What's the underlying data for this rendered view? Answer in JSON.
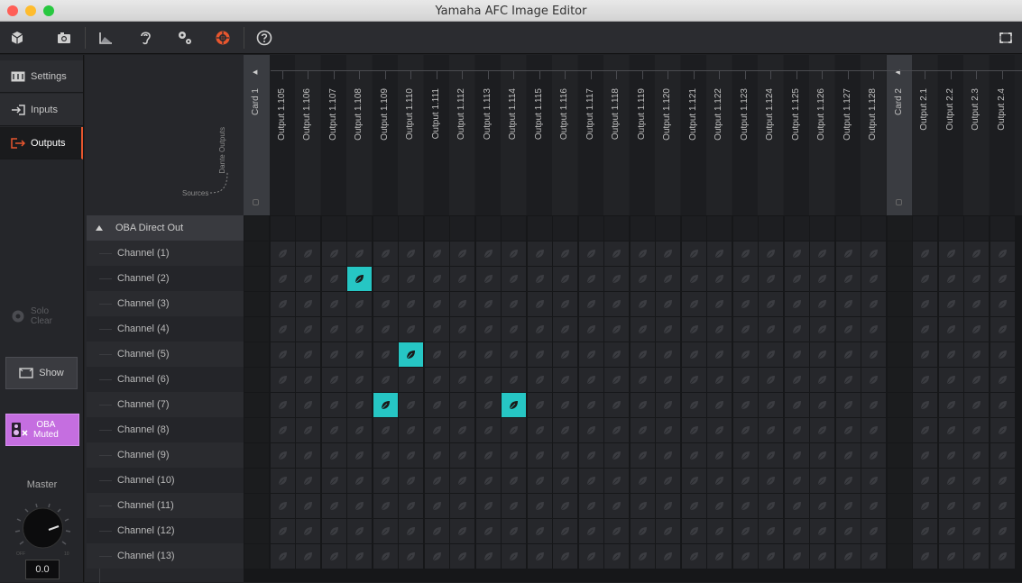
{
  "window": {
    "title": "Yamaha AFC Image Editor",
    "traffic_colors": [
      "#ff5f57",
      "#febc2e",
      "#28c840"
    ]
  },
  "toolbar": {
    "items": [
      {
        "name": "cube-icon"
      },
      {
        "name": "camera-icon"
      },
      {
        "name": "room-icon"
      },
      {
        "name": "ear-icon"
      },
      {
        "name": "gears-icon"
      },
      {
        "name": "speaker-routing-icon",
        "active": true
      },
      {
        "name": "help-icon"
      }
    ],
    "accent": "#e8562e"
  },
  "sidebar": {
    "settings_label": "Settings",
    "inputs_label": "Inputs",
    "outputs_label": "Outputs",
    "solo_label": "Solo",
    "clear_label": "Clear",
    "show_label": "Show",
    "oba_label": "OBA",
    "muted_label": "Muted",
    "master_label": "Master",
    "master_value": "0.0",
    "knob_min_label": "OFF",
    "knob_max_label": "10"
  },
  "legend": {
    "sources_label": "Sources",
    "dante_outputs_label": "Dante Outputs"
  },
  "rows": {
    "group_label": "OBA Direct Out",
    "channels": [
      "Channel (1)",
      "Channel (2)",
      "Channel (3)",
      "Channel (4)",
      "Channel (5)",
      "Channel (6)",
      "Channel (7)",
      "Channel (8)",
      "Channel (9)",
      "Channel (10)",
      "Channel (11)",
      "Channel (12)",
      "Channel (13)"
    ]
  },
  "columns": [
    {
      "label": "Card 1",
      "card": true
    },
    {
      "label": "Output 1.105"
    },
    {
      "label": "Output 1.106"
    },
    {
      "label": "Output 1.107"
    },
    {
      "label": "Output 1.108"
    },
    {
      "label": "Output 1.109"
    },
    {
      "label": "Output 1.110"
    },
    {
      "label": "Output 1.111"
    },
    {
      "label": "Output 1.112"
    },
    {
      "label": "Output 1.113"
    },
    {
      "label": "Output 1.114"
    },
    {
      "label": "Output 1.115"
    },
    {
      "label": "Output 1.116"
    },
    {
      "label": "Output 1.117"
    },
    {
      "label": "Output 1.118"
    },
    {
      "label": "Output 1.119"
    },
    {
      "label": "Output 1.120"
    },
    {
      "label": "Output 1.121"
    },
    {
      "label": "Output 1.122"
    },
    {
      "label": "Output 1.123"
    },
    {
      "label": "Output 1.124"
    },
    {
      "label": "Output 1.125"
    },
    {
      "label": "Output 1.126"
    },
    {
      "label": "Output 1.127"
    },
    {
      "label": "Output 1.128"
    },
    {
      "label": "Card 2",
      "card": true
    },
    {
      "label": "Output 2.1"
    },
    {
      "label": "Output 2.2"
    },
    {
      "label": "Output 2.3"
    },
    {
      "label": "Output 2.4"
    }
  ],
  "routing": [
    {
      "channel": "Channel (2)",
      "output": "Output 1.108"
    },
    {
      "channel": "Channel (5)",
      "output": "Output 1.110"
    },
    {
      "channel": "Channel (7)",
      "output": "Output 1.109"
    },
    {
      "channel": "Channel (7)",
      "output": "Output 1.114"
    }
  ],
  "colors": {
    "active_cell": "#26c6c4",
    "oba_muted": "#c56ee0"
  }
}
